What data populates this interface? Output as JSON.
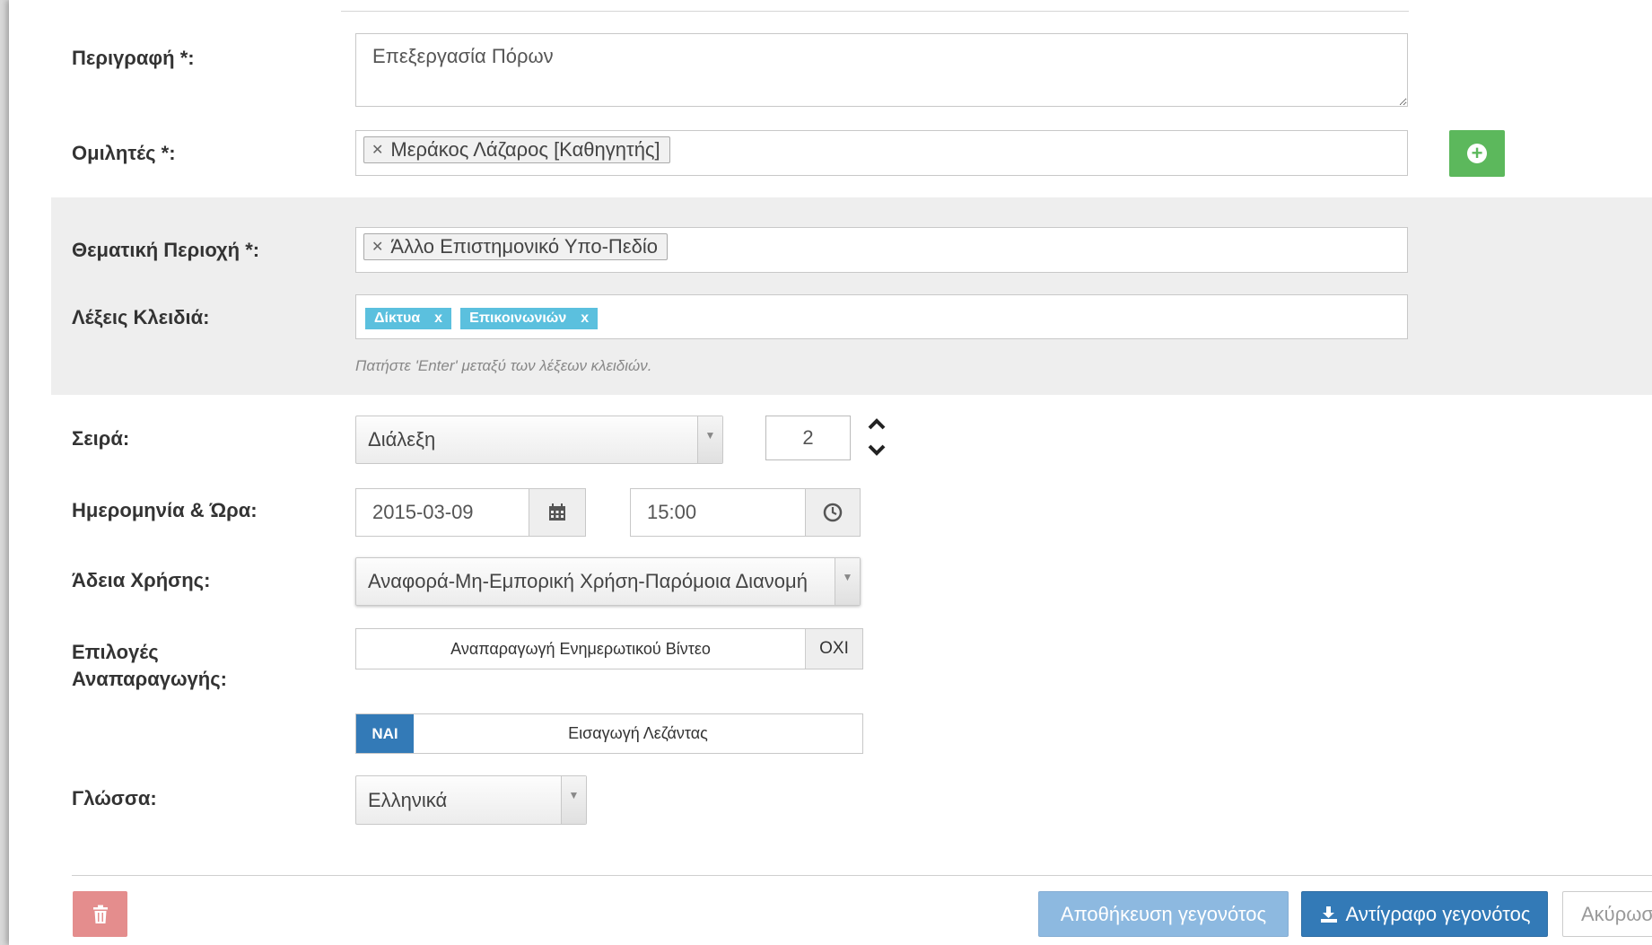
{
  "form": {
    "description": {
      "label": "Περιγραφή *:",
      "value": "Επεξεργασία Πόρων"
    },
    "speakers": {
      "label": "Ομιλητές *:",
      "chips": [
        "Μεράκος Λάζαρος [Καθηγητής]"
      ],
      "add_icon": "plus-circle-icon"
    },
    "subject_area": {
      "label": "Θεματική Περιοχή *:",
      "chips": [
        "Άλλο Επιστημονικό Υπο-Πεδίο"
      ]
    },
    "keywords": {
      "label": "Λέξεις Κλειδιά:",
      "tags": [
        "Δίκτυα",
        "Επικοινωνιών"
      ],
      "remove_glyph": "x",
      "hint": "Πατήστε 'Enter' μεταξύ των λέξεων κλειδιών."
    },
    "series": {
      "label": "Σειρά:",
      "selected": "Διάλεξη",
      "number": "2"
    },
    "datetime": {
      "label": "Ημερομηνία & Ώρα:",
      "date": "2015-03-09",
      "time": "15:00",
      "calendar_icon": "calendar-icon",
      "clock_icon": "clock-icon"
    },
    "license": {
      "label": "Άδεια Χρήσης:",
      "selected": "Αναφορά-Μη-Εμπορική Χρήση-Παρόμοια Διανομή"
    },
    "playback": {
      "label_line1": "Επιλογές",
      "label_line2": "Αναπαραγωγής:",
      "toggle1": {
        "text": "Αναπαραγωγή Ενημερωτικού Βίντεο",
        "state": "ΟΧΙ"
      },
      "toggle2": {
        "text": "Εισαγωγή Λεζάντας",
        "state": "ΝΑΙ"
      }
    },
    "language": {
      "label": "Γλώσσα:",
      "selected": "Ελληνικά"
    }
  },
  "footer": {
    "delete_icon": "trash-icon",
    "save_label": "Αποθήκευση γεγονότος",
    "copy_label": "Αντίγραφο γεγονότος",
    "copy_icon": "copy-icon",
    "cancel_label": "Ακύρωση"
  },
  "colors": {
    "primary": "#337ab7",
    "success": "#5cb85c",
    "danger_light": "#e48d8d",
    "tag": "#5bc0de"
  }
}
